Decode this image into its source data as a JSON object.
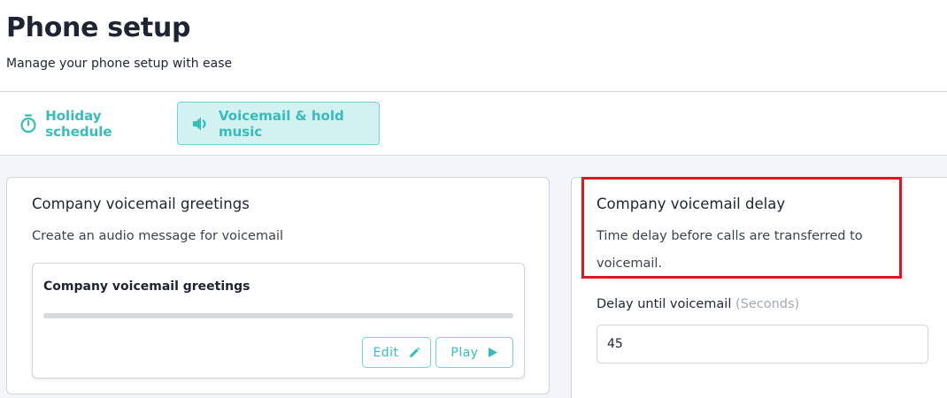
{
  "header": {
    "title": "Phone setup",
    "subtitle": "Manage your phone setup with ease"
  },
  "tabs": [
    {
      "label": "Holiday schedule",
      "icon": "stopwatch-icon",
      "active": false
    },
    {
      "label": "Voicemail & hold music",
      "icon": "speaker-icon",
      "active": true
    }
  ],
  "greetings_card": {
    "title": "Company voicemail greetings",
    "description": "Create an audio message for voicemail",
    "player": {
      "title": "Company voicemail greetings",
      "progress": 0,
      "edit_label": "Edit",
      "play_label": "Play"
    }
  },
  "delay_card": {
    "title": "Company voicemail delay",
    "description_line1": "Time delay before calls are transferred to",
    "description_line2": "voicemail.",
    "field_label": "Delay until voicemail",
    "field_unit": "(Seconds)",
    "field_value": "45"
  },
  "colors": {
    "accent": "#36bcbc",
    "accent_bg": "#d2f2f1",
    "highlight": "#e1141f"
  }
}
